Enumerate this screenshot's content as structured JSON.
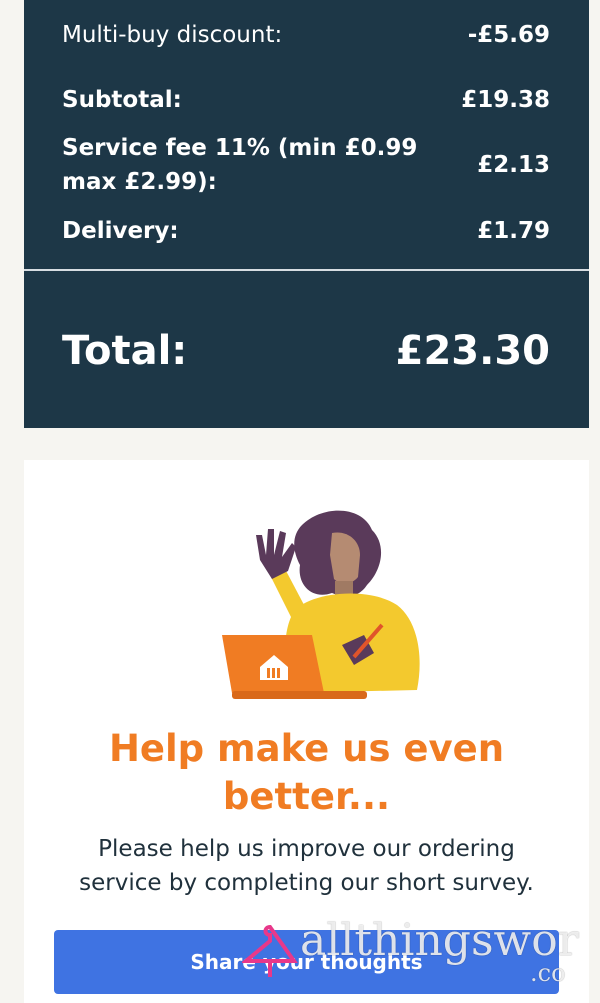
{
  "summary": {
    "multibuy_label": "Multi-buy discount:",
    "multibuy_value": "-£5.69",
    "subtotal_label": "Subtotal:",
    "subtotal_value": "£19.38",
    "service_label": "Service fee 11% (min £0.99 max £2.99):",
    "service_value": "£2.13",
    "delivery_label": "Delivery:",
    "delivery_value": "£1.79",
    "total_label": "Total:",
    "total_value": "£23.30"
  },
  "survey": {
    "title": "Help make us even better...",
    "text": "Please help us improve our ordering service by completing our short survey.",
    "button_label": "Share your thoughts"
  },
  "watermark": {
    "main": "allthingswor",
    "sub": ".co"
  },
  "colors": {
    "summary_bg": "#1d3747",
    "accent_orange": "#f07c23",
    "button_blue": "#3f73e2",
    "page_bg": "#f6f5f1"
  }
}
